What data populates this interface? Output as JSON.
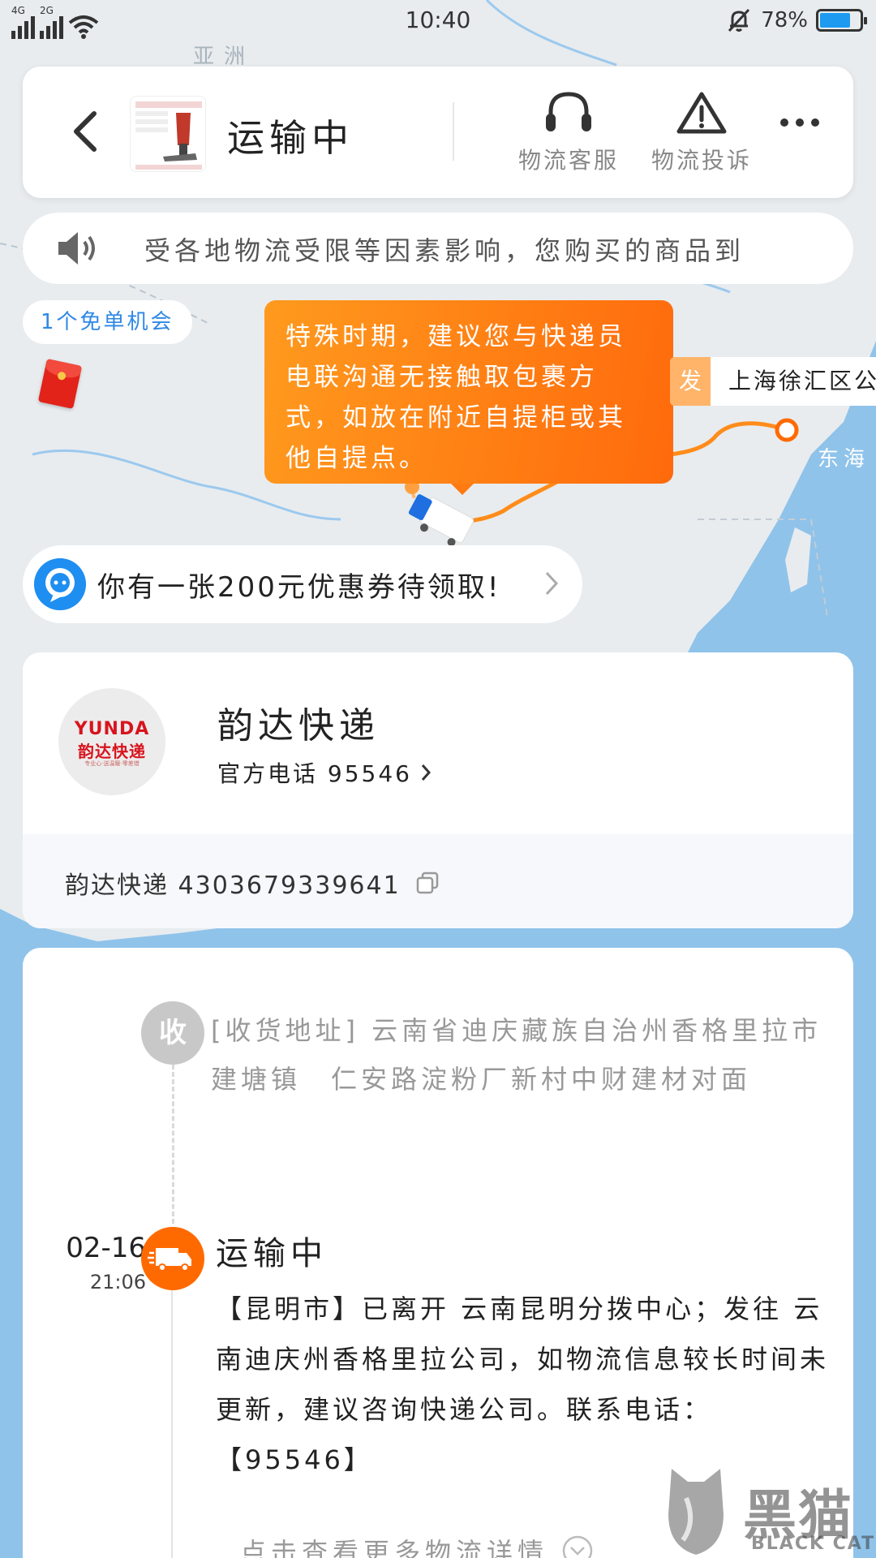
{
  "status_bar": {
    "net1": "4G",
    "net2": "2G",
    "time": "10:40",
    "battery_pct": "78%",
    "battery_level": 0.78
  },
  "header": {
    "title": "运输中",
    "service_label": "物流客服",
    "complaint_label": "物流投诉"
  },
  "notice": {
    "text": "受各地物流受限等因素影响，您购买的商品到"
  },
  "map": {
    "free_chance": "1个免单机会",
    "tip_text": "特殊时期，建议您与快递员电联沟通无接触取包裹方式，如放在附近自提柜或其他自提点。",
    "origin_tag": "发",
    "origin_name": "上海徐汇区公",
    "map_labels": {
      "asia": "亚洲",
      "east_sea": "东海"
    }
  },
  "coupon": {
    "text": "你有一张200元优惠券待领取!"
  },
  "carrier": {
    "logo_en": "YUNDA",
    "logo_cn": "韵达快递",
    "logo_sub": "专业心·送温暖·零差错",
    "name": "韵达快递",
    "phone": "官方电话 95546",
    "tracking": "韵达快递 4303679339641"
  },
  "timeline": {
    "recv_badge": "收",
    "recv_address": "[收货地址] 云南省迪庆藏族自治州香格里拉市 建塘镇　仁安路淀粉厂新村中财建材对面",
    "event": {
      "date": "02-16",
      "time": "21:06",
      "status": "运输中",
      "desc": "【昆明市】已离开 云南昆明分拨中心；发往 云南迪庆州香格里拉公司，如物流信息较长时间未更新，建议咨询快递公司。联系电话：【95546】"
    },
    "more_label": "点击查看更多物流详情"
  },
  "watermark": {
    "cn": "黑猫",
    "en": "BLACK CAT"
  },
  "colors": {
    "accent_orange": "#ff6a00",
    "link_blue": "#2e88e6",
    "sea": "#8fc3ea",
    "land": "#e8ecef"
  }
}
